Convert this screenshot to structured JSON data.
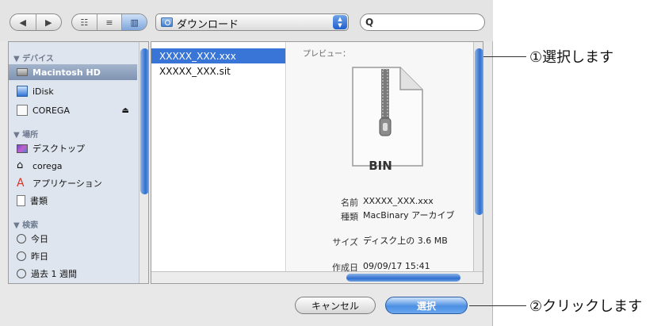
{
  "toolbar": {
    "nav_back": "◀",
    "nav_forward": "▶",
    "view_icons": "☷",
    "view_list": "≡",
    "view_columns": "▥",
    "location": "ダウンロード",
    "search_placeholder": ""
  },
  "sidebar": {
    "sections": [
      {
        "title": "▼ デバイス"
      },
      {
        "title": "▼ 場所"
      },
      {
        "title": "▼ 検索"
      }
    ],
    "devices": [
      "Macintosh HD",
      "iDisk",
      "COREGA"
    ],
    "places": [
      "デスクトップ",
      "corega",
      "アプリケーション",
      "書類"
    ],
    "search": [
      "今日",
      "昨日",
      "過去 1 週間"
    ]
  },
  "files": [
    "XXXXX_XXX.xxx",
    "XXXXX_XXX.sit"
  ],
  "preview": {
    "heading": "プレビュー：",
    "file_kind": "BIN",
    "name_label": "名前",
    "name_value": "XXXXX_XXX.xxx",
    "kind_label": "種類",
    "kind_value": "MacBinary アーカイブ",
    "size_label": "サイズ",
    "size_value": "ディスク上の 3.6 MB",
    "created_label": "作成日",
    "created_value": "09/09/17 15:41"
  },
  "buttons": {
    "cancel": "キャンセル",
    "choose": "選択"
  },
  "callouts": {
    "step1": "①選択します",
    "step2": "②クリックします"
  },
  "colors": {
    "selection": "#3875d7",
    "sidebar_bg": "#dfe5ee",
    "primary_button": "#4c8fe3"
  }
}
